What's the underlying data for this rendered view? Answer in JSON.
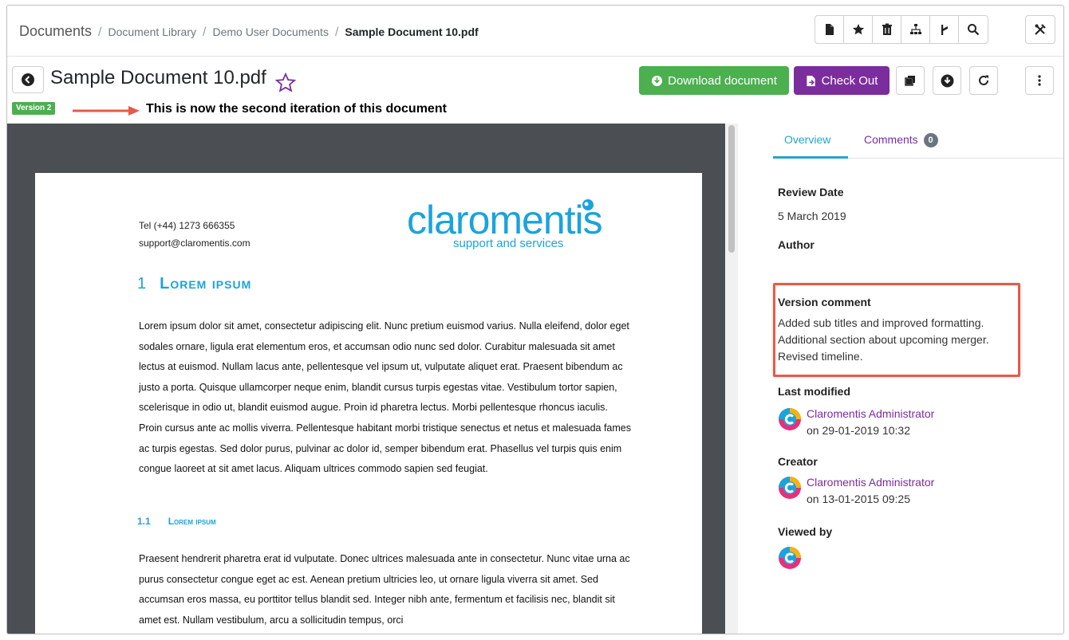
{
  "breadcrumb": {
    "root": "Documents",
    "library": "Document Library",
    "folder": "Demo User Documents",
    "current": "Sample Document 10.pdf",
    "separator": "/"
  },
  "toolbar_icons": [
    "document-icon",
    "star-icon",
    "trash-icon",
    "sitemap-icon",
    "branch-icon",
    "search-icon"
  ],
  "admin_icon": "tools-icon",
  "document": {
    "title": "Sample Document 10.pdf",
    "version_badge": "Version 2",
    "annotation": "This is now the second iteration of this document"
  },
  "actions": {
    "download_label": "Download document",
    "checkout_label": "Check Out"
  },
  "colors": {
    "download": "#4caf50",
    "checkout": "#7b2d9e",
    "accent": "#1aa3dc",
    "highlight_box": "#e65a4a"
  },
  "preview": {
    "phone": "Tel (+44) 1273 666355",
    "email": "support@claromentis.com",
    "logo_name": "claromentis",
    "logo_tagline": "support and services",
    "heading1_number": "1",
    "heading1": "Lorem ipsum",
    "paragraph1": "Lorem ipsum dolor sit amet, consectetur adipiscing elit. Nunc pretium euismod varius. Nulla eleifend, dolor eget sodales ornare, ligula erat elementum eros, et accumsan odio nunc sed dolor. Curabitur malesuada sit amet lectus at euismod. Nullam lacus ante, pellentesque vel ipsum ut, vulputate aliquet erat. Praesent bibendum ac justo a porta. Quisque ullamcorper neque enim, blandit cursus turpis egestas vitae. Vestibulum tortor sapien, scelerisque in odio ut, blandit euismod augue. Proin id pharetra lectus. Morbi pellentesque rhoncus iaculis. Proin cursus ante ac mollis viverra. Pellentesque habitant morbi tristique senectus et netus et malesuada fames ac turpis egestas. Sed dolor purus, pulvinar ac dolor id, semper bibendum erat. Phasellus vel turpis quis enim congue laoreet at sit amet lacus. Aliquam ultrices commodo sapien sed feugiat.",
    "heading2_number": "1.1",
    "heading2": "Lorem ipsum",
    "paragraph2": "Praesent hendrerit pharetra erat id vulputate. Donec ultrices malesuada ante in consectetur. Nunc vitae urna ac purus consectetur congue eget ac est. Aenean pretium ultricies leo, ut ornare ligula viverra sit amet. Sed accumsan eros massa, eu porttitor tellus blandit sed. Integer nibh ante, fermentum et facilisis nec, blandit sit amet est. Nullam vestibulum, arcu a sollicitudin tempus, orci"
  },
  "side": {
    "tab_overview": "Overview",
    "tab_comments": "Comments",
    "comments_count": "0",
    "review_date_label": "Review Date",
    "review_date": "5 March 2019",
    "author_label": "Author",
    "version_comment_label": "Version comment",
    "version_comment": "Added sub titles and improved formatting. Additional section about upcoming merger. Revised timeline.",
    "last_modified_label": "Last modified",
    "last_modified_by": "Claromentis Administrator",
    "last_modified_on": "on 29-01-2019 10:32",
    "creator_label": "Creator",
    "creator_name": "Claromentis Administrator",
    "creator_on": "on 13-01-2015 09:25",
    "viewed_by_label": "Viewed by"
  }
}
